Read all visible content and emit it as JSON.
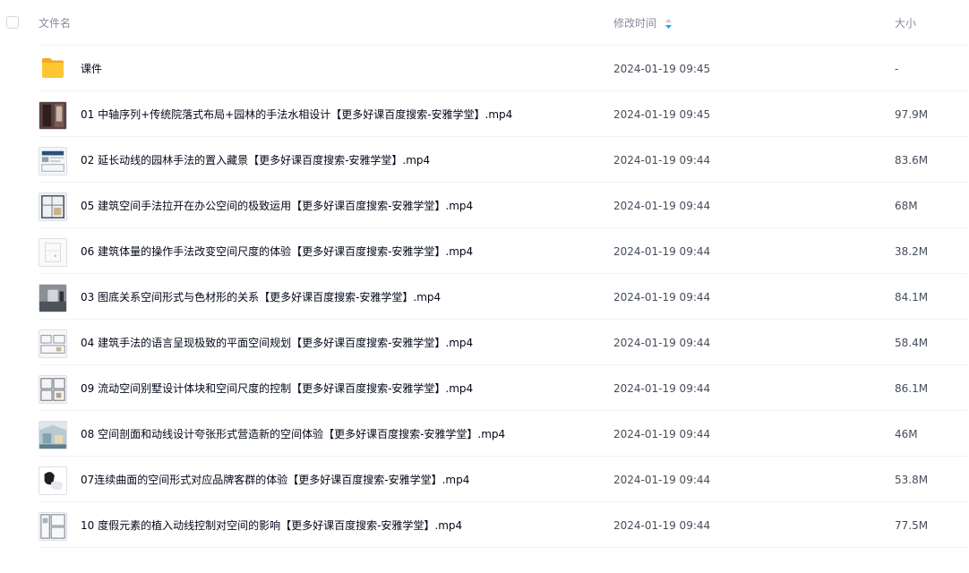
{
  "header": {
    "name_label": "文件名",
    "time_label": "修改时间",
    "size_label": "大小",
    "sort_icon": "sort-icon"
  },
  "files": [
    {
      "name": "课件",
      "time": "2024-01-19 09:45",
      "size": "-",
      "icon": "folder-icon"
    },
    {
      "name": "01 中轴序列+传统院落式布局+园林的手法水相设计【更多好课百度搜索-安雅学堂】.mp4",
      "time": "2024-01-19 09:45",
      "size": "97.9M",
      "icon": "video-thumbnail"
    },
    {
      "name": "02 延长动线的园林手法的置入藏景【更多好课百度搜索-安雅学堂】.mp4",
      "time": "2024-01-19 09:44",
      "size": "83.6M",
      "icon": "video-thumbnail"
    },
    {
      "name": "05 建筑空间手法拉开在办公空间的极致运用【更多好课百度搜索-安雅学堂】.mp4",
      "time": "2024-01-19 09:44",
      "size": "68M",
      "icon": "video-thumbnail"
    },
    {
      "name": "06 建筑体量的操作手法改变空间尺度的体验【更多好课百度搜索-安雅学堂】.mp4",
      "time": "2024-01-19 09:44",
      "size": "38.2M",
      "icon": "video-thumbnail"
    },
    {
      "name": "03 图底关系空间形式与色材形的关系【更多好课百度搜索-安雅学堂】.mp4",
      "time": "2024-01-19 09:44",
      "size": "84.1M",
      "icon": "video-thumbnail"
    },
    {
      "name": "04 建筑手法的语言呈现极致的平面空间规划【更多好课百度搜索-安雅学堂】.mp4",
      "time": "2024-01-19 09:44",
      "size": "58.4M",
      "icon": "video-thumbnail"
    },
    {
      "name": "09 流动空间别墅设计体块和空间尺度的控制【更多好课百度搜索-安雅学堂】.mp4",
      "time": "2024-01-19 09:44",
      "size": "86.1M",
      "icon": "video-thumbnail"
    },
    {
      "name": "08 空间剖面和动线设计夸张形式营造新的空间体验【更多好课百度搜索-安雅学堂】.mp4",
      "time": "2024-01-19 09:44",
      "size": "46M",
      "icon": "video-thumbnail"
    },
    {
      "name": "07连续曲面的空间形式对应品牌客群的体验【更多好课百度搜索-安雅学堂】.mp4",
      "time": "2024-01-19 09:44",
      "size": "53.8M",
      "icon": "video-thumbnail"
    },
    {
      "name": "10 度假元素的植入动线控制对空间的影响【更多好课百度搜索-安雅学堂】.mp4",
      "time": "2024-01-19 09:44",
      "size": "77.5M",
      "icon": "video-thumbnail"
    }
  ],
  "colors": {
    "folder": "#ffc633",
    "folder_back": "#f5a623",
    "sort_accent": "#06a7ff",
    "divider": "#f1f2f4"
  }
}
